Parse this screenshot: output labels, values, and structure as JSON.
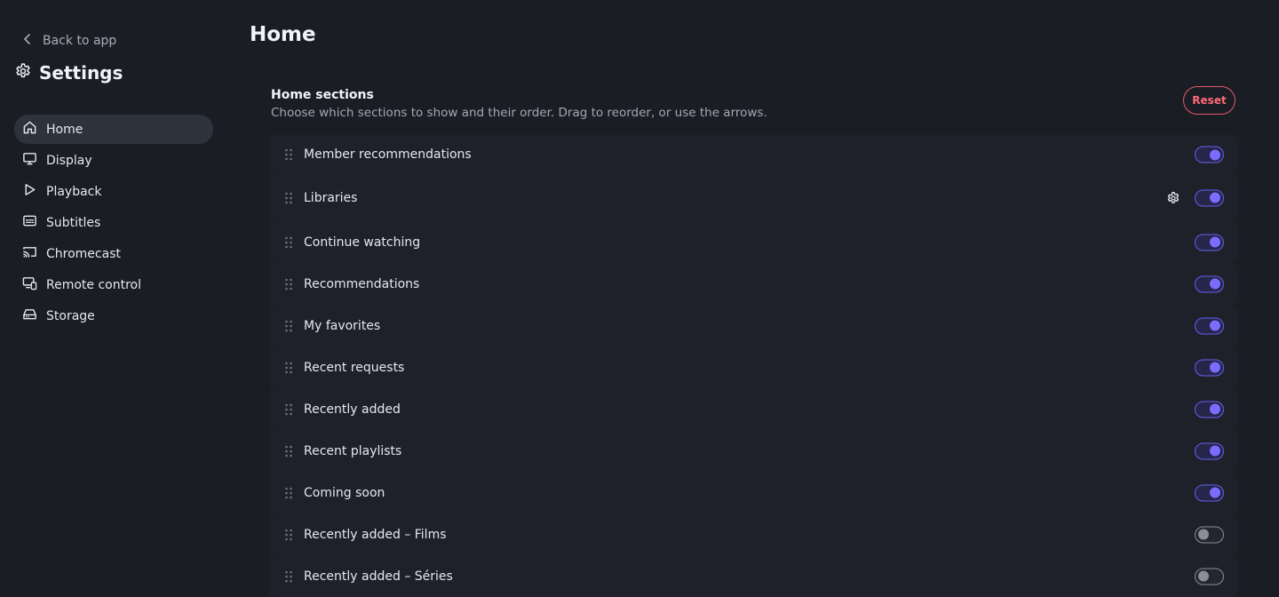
{
  "sidebar": {
    "back_label": "Back to app",
    "title": "Settings",
    "items": [
      {
        "label": "Home",
        "icon": "home-icon",
        "active": true
      },
      {
        "label": "Display",
        "icon": "monitor-icon",
        "active": false
      },
      {
        "label": "Playback",
        "icon": "play-icon",
        "active": false
      },
      {
        "label": "Subtitles",
        "icon": "subtitles-icon",
        "active": false
      },
      {
        "label": "Chromecast",
        "icon": "cast-icon",
        "active": false
      },
      {
        "label": "Remote control",
        "icon": "remote-icon",
        "active": false
      },
      {
        "label": "Storage",
        "icon": "storage-icon",
        "active": false
      }
    ]
  },
  "main": {
    "title": "Home",
    "section": {
      "title": "Home sections",
      "description": "Choose which sections to show and their order. Drag to reorder, or use the arrows.",
      "reset_label": "Reset"
    },
    "rows": [
      {
        "label": "Member recommendations",
        "enabled": true,
        "has_settings": false
      },
      {
        "label": "Libraries",
        "enabled": true,
        "has_settings": true
      },
      {
        "label": "Continue watching",
        "enabled": true,
        "has_settings": false
      },
      {
        "label": "Recommendations",
        "enabled": true,
        "has_settings": false
      },
      {
        "label": "My favorites",
        "enabled": true,
        "has_settings": false
      },
      {
        "label": "Recent requests",
        "enabled": true,
        "has_settings": false
      },
      {
        "label": "Recently added",
        "enabled": true,
        "has_settings": false
      },
      {
        "label": "Recent playlists",
        "enabled": true,
        "has_settings": false
      },
      {
        "label": "Coming soon",
        "enabled": true,
        "has_settings": false
      },
      {
        "label": "Recently added – Films",
        "enabled": false,
        "has_settings": false
      },
      {
        "label": "Recently added – Séries",
        "enabled": false,
        "has_settings": false
      }
    ]
  },
  "colors": {
    "background": "#1a1d24",
    "row_background": "#1e212a",
    "accent": "#7a6cff",
    "reset": "#ff6b7a"
  }
}
